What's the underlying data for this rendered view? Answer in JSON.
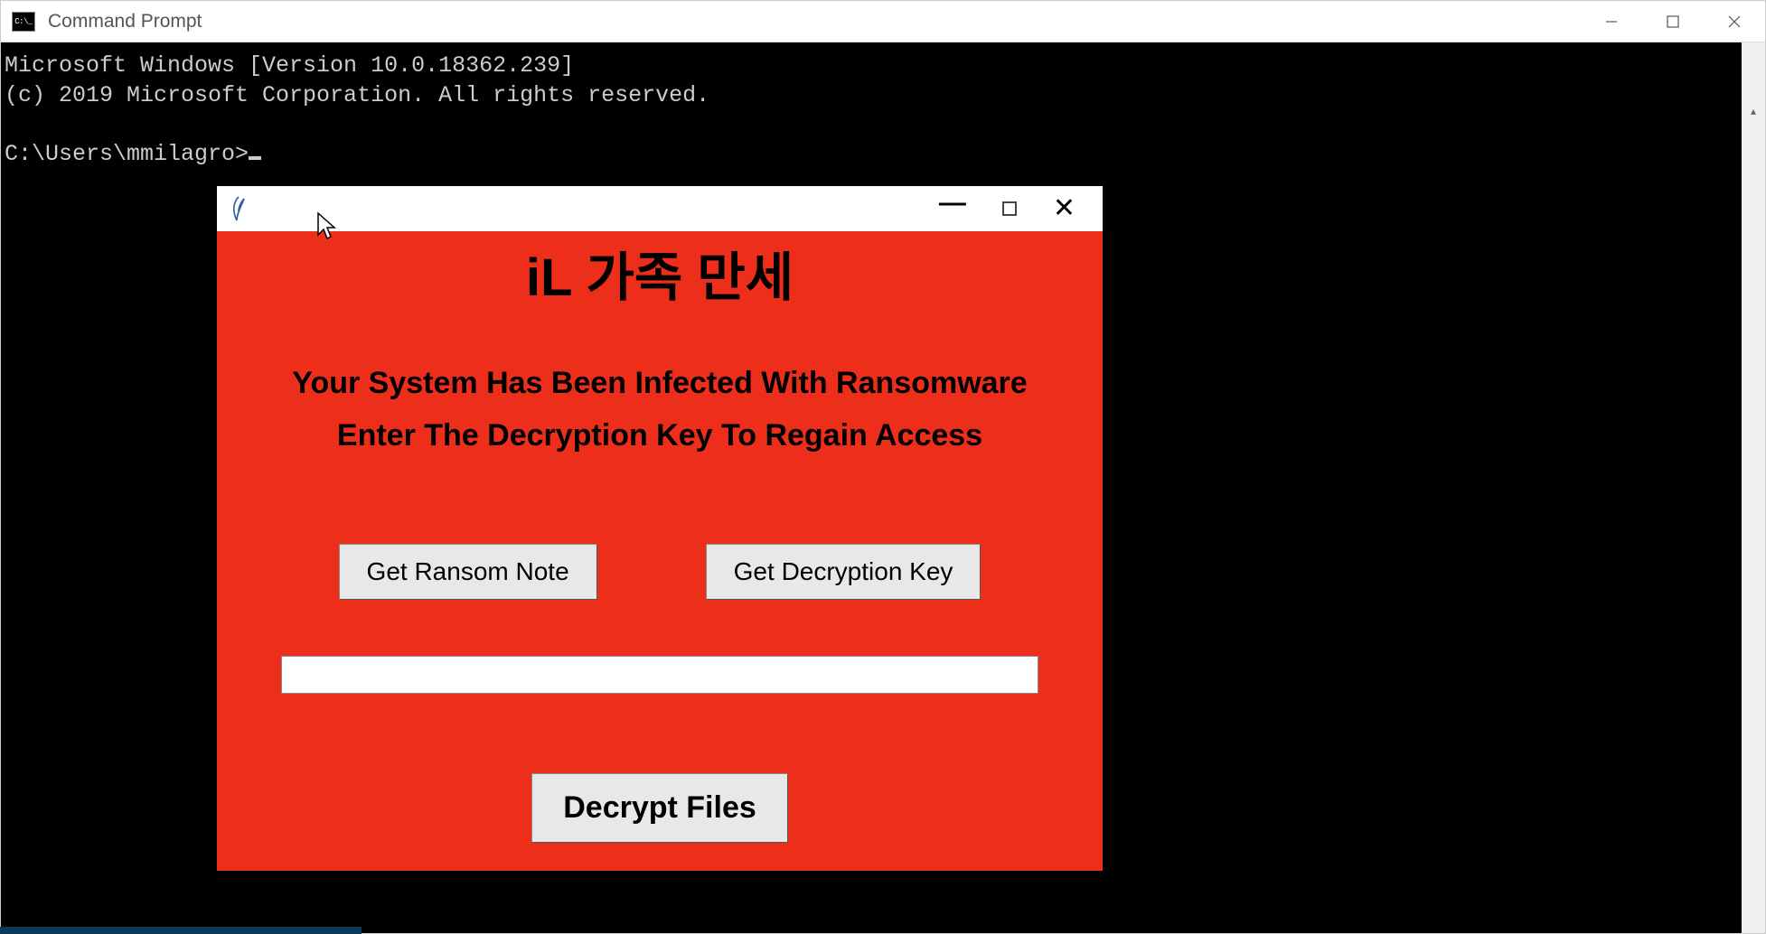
{
  "cmd": {
    "title": "Command Prompt",
    "line1": "Microsoft Windows [Version 10.0.18362.239]",
    "line2": "(c) 2019 Microsoft Corporation. All rights reserved.",
    "prompt": "C:\\Users\\mmilagro>"
  },
  "window_controls": {
    "minimize": "—",
    "maximize": "☐",
    "close": "✕"
  },
  "ransom": {
    "heading": "iL 가족 만세",
    "message_line1": "Your System Has Been Infected With Ransomware",
    "message_line2": "Enter The Decryption Key To Regain Access",
    "get_note_label": "Get Ransom Note",
    "get_key_label": "Get Decryption Key",
    "decrypt_label": "Decrypt Files",
    "input_value": ""
  }
}
